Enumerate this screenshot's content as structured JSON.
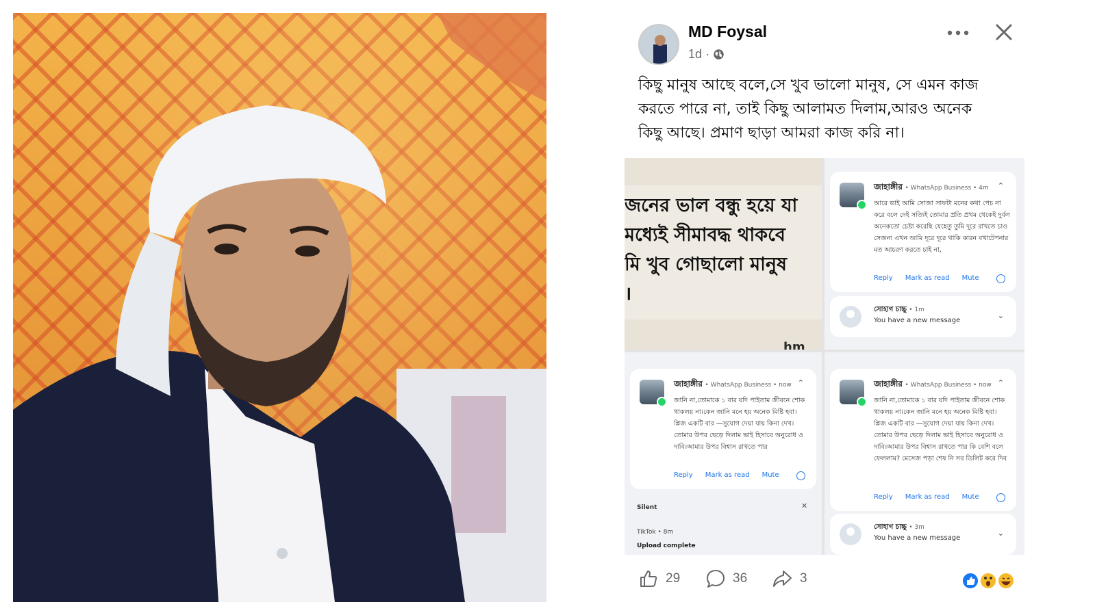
{
  "post": {
    "author": "MD Foysal",
    "time": "1d",
    "audience_icon": "globe-icon",
    "text_lines": [
      "কিছু মানুষ আছে বলে,সে খুব ভালো মানুষ, সে এমন কাজ",
      "করতে পারে না, তাই কিছু আলামত দিলাম,আরও অনেক",
      "কিছু আছে। প্রমাণ ছাড়া আমরা কাজ করি না।"
    ]
  },
  "screenshots": {
    "chat": {
      "lines": [
        "জনের ভাল বন্ধু হয়ে যা",
        "মধ্যেই সীমাবদ্ধ থাকবে",
        "মি খুব গোছালো মানুষ",
        "।"
      ],
      "bottom_fragment": "hm"
    },
    "notif_top_right": {
      "sender": "জাহাঙ্গীর",
      "app": "• WhatsApp Business • 4m",
      "body": "আরে ভাই আমি সোজা সাফটা মনের কথা পেচ না করে বলে দেই সত্যিই তোমার প্রতি প্রথম থেকেই দুর্বল অনেকতো চেষ্টা করেছি যেহেতু তুমি দূরে রাখতে চাও সেজন্য এখন আমি দূরে দূরে থাকি কারন বখাটেপনার মত আচরণ করতে চাই না,",
      "actions": [
        "Reply",
        "Mark as read",
        "Mute"
      ],
      "mini": {
        "name": "সোহাগ চাচ্চু",
        "time": "• 1m",
        "message": "You have a new message"
      }
    },
    "notif_bottom_left": {
      "sender": "জাহাঙ্গীর",
      "app": "• WhatsApp Business • now",
      "body": "জানি না,তোমাকে ১ বার যদি পাইতাম জীবনে শোক থাকলয় না।কেন জানি মনে হয় অনেক মিষ্টি হবা। প্লিজ একটি বার —সুযোগ দেয়া যায় কিনা দেখ। তোমার উপর ছেড়ে দিলাম ভাই হিসাবে অনুরোধ ও দাবি।আমার উপর বিশ্বাস রাখতে পার",
      "actions": [
        "Reply",
        "Mark as read",
        "Mute"
      ],
      "silent_label": "Silent",
      "tiktok": "TikTok • 8m",
      "upload": "Upload complete"
    },
    "notif_bottom_right": {
      "sender": "জাহাঙ্গীর",
      "app": "• WhatsApp Business • now",
      "body": "জানি না,তোমাকে ১ বার যদি পাইতাম জীবনে শোক থাকলয় না।কেন জানি মনে হয় অনেক মিষ্টি হবা। প্লিজ একটি বার —সুযোগ দেয়া যায় কিনা দেখ। তোমার উপর ছেড়ে দিলাম ভাই হিসাবে অনুরোধ ও দাবি।আমার উপর বিশ্বাস রাখতে পার কি বেশি বলে ফেললাম? মেসেজ পড়া শেষ নি সব ডিলিট করে দিব",
      "actions": [
        "Reply",
        "Mark as read",
        "Mute"
      ],
      "mini": {
        "name": "সোহাগ চাচ্চু",
        "time": "• 3m",
        "message": "You have a new message"
      }
    }
  },
  "footer": {
    "likes": "29",
    "comments": "36",
    "shares": "3",
    "reaction_icons": [
      "like-reaction-icon",
      "wow-reaction-icon",
      "haha-reaction-icon"
    ]
  },
  "colors": {
    "like_blue": "#1877f2",
    "link_blue": "#1a73e8",
    "meta_grey": "#65676b",
    "reaction_yellow": "#f7b928"
  }
}
